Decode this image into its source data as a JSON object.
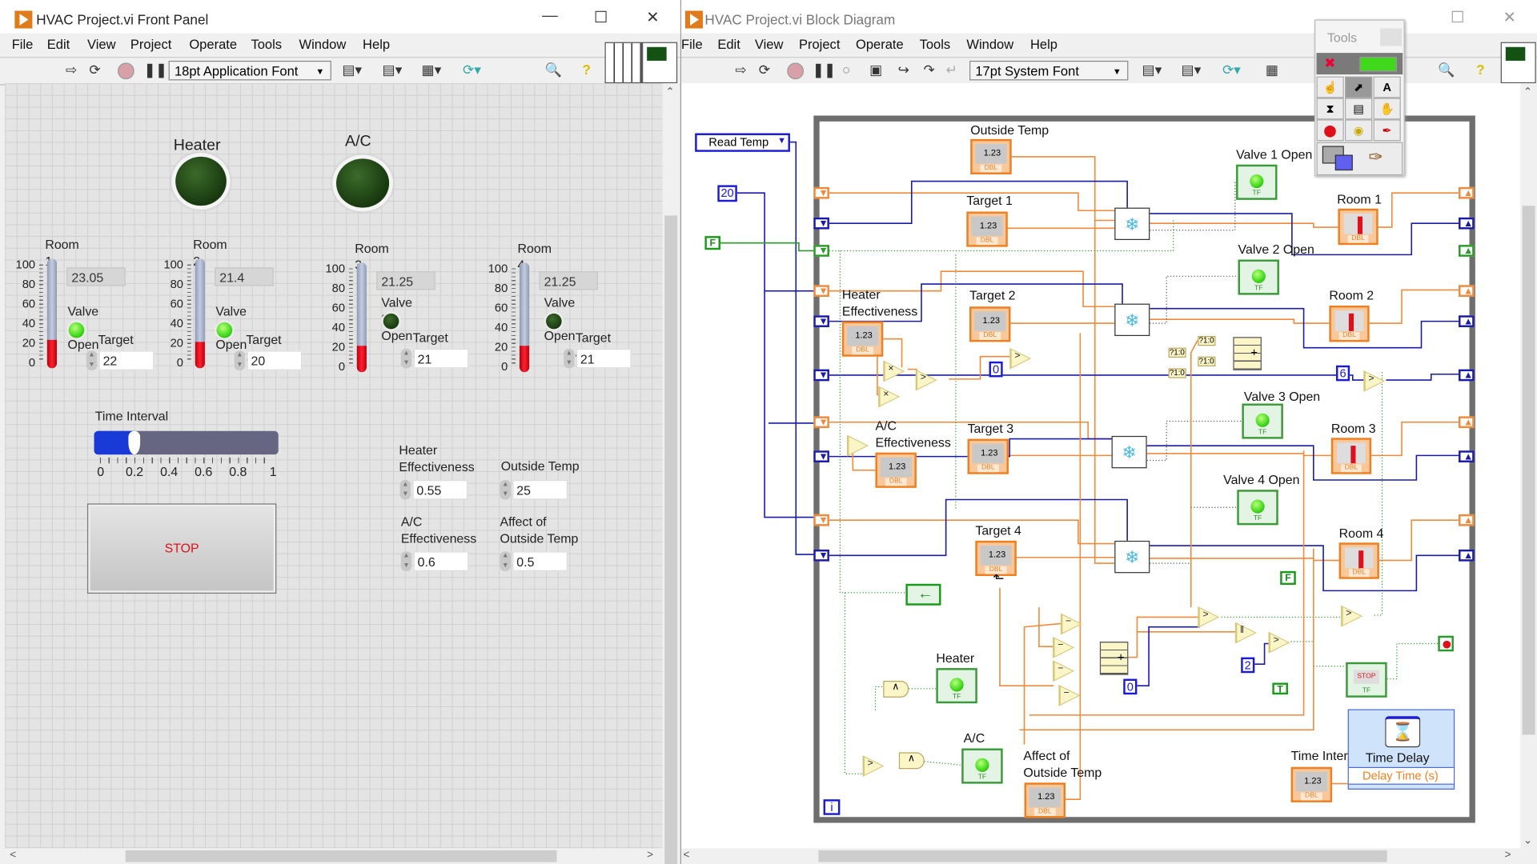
{
  "front_panel": {
    "title": "HVAC Project.vi Front Panel",
    "menu": [
      "File",
      "Edit",
      "View",
      "Project",
      "Operate",
      "Tools",
      "Window",
      "Help"
    ],
    "font_select": "18pt Application Font",
    "heater": {
      "label": "Heater",
      "on": false
    },
    "ac": {
      "label": "A/C",
      "on": false
    },
    "thermo_scale": [
      "100",
      "80",
      "60",
      "40",
      "20",
      "0"
    ],
    "rooms": [
      {
        "label": "Room 1",
        "temp": "23.05",
        "valve_label": "Valve 1 Open",
        "valve_open": true,
        "target_label": "Target 1",
        "target": "22"
      },
      {
        "label": "Room 2",
        "temp": "21.4",
        "valve_label": "Valve 2 Open",
        "valve_open": true,
        "target_label": "Target 2",
        "target": "20"
      },
      {
        "label": "Room 3",
        "temp": "21.25",
        "valve_label": "Valve 3 Open",
        "valve_open": false,
        "target_label": "Target 3",
        "target": "21"
      },
      {
        "label": "Room 4",
        "temp": "21.25",
        "valve_label": "Valve 4 Open",
        "valve_open": false,
        "target_label": "Target 4",
        "target": "21"
      }
    ],
    "time_interval": {
      "label": "Time Interval",
      "value": 0.2,
      "ticks": [
        "0",
        "0.2",
        "0.4",
        "0.6",
        "0.8",
        "1"
      ]
    },
    "heater_eff": {
      "label": "Heater\nEffectiveness",
      "value": "0.55"
    },
    "outside_temp": {
      "label": "Outside Temp",
      "value": "25"
    },
    "ac_eff": {
      "label": "A/C\nEffectiveness",
      "value": "0.6"
    },
    "affect_outside": {
      "label": "Affect of\nOutside Temp",
      "value": "0.5"
    },
    "stop_label": "STOP",
    "colors": {
      "accent_stop": "#e0101a",
      "led_on": "#3fd81a",
      "thermo_fill": "#e0101a",
      "slider_fill": "#1a3ad8"
    }
  },
  "block_diagram": {
    "title": "HVAC Project.vi Block Diagram",
    "menu": [
      "File",
      "Edit",
      "View",
      "Project",
      "Operate",
      "Tools",
      "Window",
      "Help"
    ],
    "font_select": "17pt System Font",
    "enum_label": "Read Temp",
    "tools_title": "Tools",
    "controls": {
      "outside_temp": "Outside Temp",
      "target1": "Target 1",
      "target2": "Target 2",
      "target3": "Target 3",
      "target4": "Target 4",
      "heater_eff": "Heater\nEffectiveness",
      "ac_eff": "A/C\nEffectiveness",
      "affect_outside": "Affect of\nOutside Temp",
      "time_interval": "Time Interval"
    },
    "indicators": {
      "valve1": "Valve 1 Open",
      "valve2": "Valve 2 Open",
      "valve3": "Valve 3 Open",
      "valve4": "Valve 4 Open",
      "room1": "Room 1",
      "room2": "Room 2",
      "room3": "Room 3",
      "room4": "Room 4",
      "heater": "Heater",
      "ac": "A/C"
    },
    "terminal_types": {
      "dbl": "DBL",
      "tf": "TF",
      "num": "1.23"
    },
    "constants": {
      "c20": "20",
      "f1": "F",
      "zero1": "0",
      "six": "6",
      "zero2": "0",
      "two": "2",
      "f2": "F",
      "t": "T",
      "select": "?1:0",
      "iteration": "i"
    },
    "time_delay": {
      "title": "Time Delay",
      "input": "Delay Time (s)"
    },
    "stop_terminal": "STOP"
  }
}
